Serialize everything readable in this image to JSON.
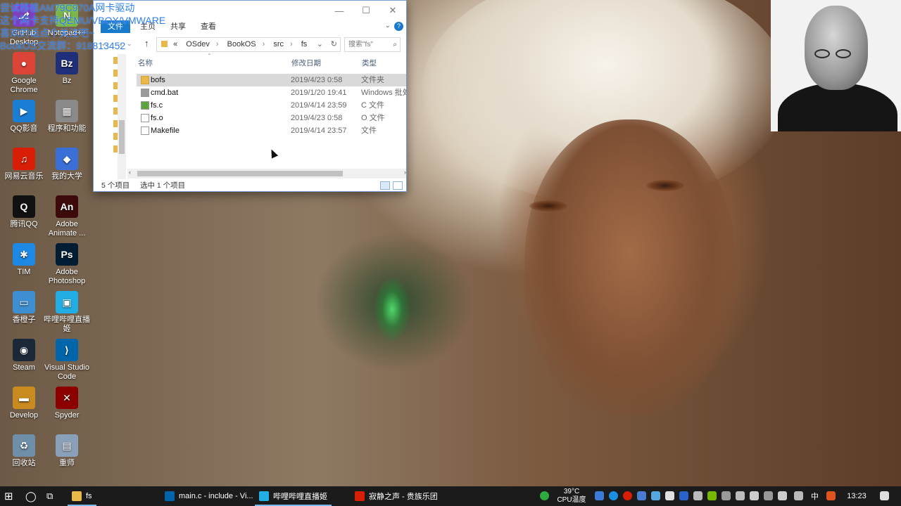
{
  "overlay": {
    "lines": [
      "尝试移植AM79C970A网卡驱动",
      "这个网卡支持QEMU/VBOX/VMWARE",
      "喜欢的话点个关注吧~",
      "BookOS交流群：918813452"
    ]
  },
  "desktop": {
    "icons": [
      {
        "label": "GitHub Desktop",
        "glyph": "⎇",
        "color": "#7b3fbf"
      },
      {
        "label": "Notepad++",
        "glyph": "N",
        "color": "#7ab648"
      },
      {
        "label": "Google Chrome",
        "glyph": "●",
        "color": "#db4437"
      },
      {
        "label": "Bz",
        "glyph": "Bz",
        "color": "#1f2f7a"
      },
      {
        "label": "QQ影音",
        "glyph": "▶",
        "color": "#1a7fd4"
      },
      {
        "label": "程序和功能",
        "glyph": "▦",
        "color": "#8a8a8a"
      },
      {
        "label": "网易云音乐",
        "glyph": "♫",
        "color": "#d81e06"
      },
      {
        "label": "我的大学",
        "glyph": "◆",
        "color": "#3a6fd8"
      },
      {
        "label": "腾讯QQ",
        "glyph": "Q",
        "color": "#111111"
      },
      {
        "label": "Adobe Animate ...",
        "glyph": "An",
        "color": "#3c0a0a"
      },
      {
        "label": "TIM",
        "glyph": "✱",
        "color": "#1e88e5"
      },
      {
        "label": "Adobe Photoshop",
        "glyph": "Ps",
        "color": "#001d34"
      },
      {
        "label": "香橙子",
        "glyph": "▭",
        "color": "#3d8fd1"
      },
      {
        "label": "哔哩哔哩直播姬",
        "glyph": "▣",
        "color": "#23ade5"
      },
      {
        "label": "Steam",
        "glyph": "◉",
        "color": "#1b2838"
      },
      {
        "label": "Visual Studio Code",
        "glyph": "⟩",
        "color": "#0065a9"
      },
      {
        "label": "Develop",
        "glyph": "▬",
        "color": "#c98a1f"
      },
      {
        "label": "Spyder",
        "glyph": "✕",
        "color": "#8c0000"
      },
      {
        "label": "回收站",
        "glyph": "♻",
        "color": "#6f8fa8"
      },
      {
        "label": "重师",
        "glyph": "▤",
        "color": "#8aa0b8"
      }
    ]
  },
  "explorer": {
    "ribbon_tabs": [
      "文件",
      "主页",
      "共享",
      "查看"
    ],
    "address_prefix": "«",
    "breadcrumbs": [
      "OSdev",
      "BookOS",
      "src",
      "fs"
    ],
    "search_placeholder": "搜索\"fs\"",
    "columns": {
      "name": "名称",
      "date": "修改日期",
      "type": "类型"
    },
    "files": [
      {
        "name": "bofs",
        "date": "2019/4/23 0:58",
        "type": "文件夹",
        "kind": "folder",
        "selected": true
      },
      {
        "name": "cmd.bat",
        "date": "2019/1/20 19:41",
        "type": "Windows 批处",
        "kind": "bat",
        "selected": false
      },
      {
        "name": "fs.c",
        "date": "2019/4/14 23:59",
        "type": "C 文件",
        "kind": "c",
        "selected": false
      },
      {
        "name": "fs.o",
        "date": "2019/4/23 0:58",
        "type": "O 文件",
        "kind": "o",
        "selected": false
      },
      {
        "name": "Makefile",
        "date": "2019/4/14 23:57",
        "type": "文件",
        "kind": "file",
        "selected": false
      }
    ],
    "status_count": "5 个项目",
    "status_selected": "选中 1 个项目"
  },
  "taskbar": {
    "windows": [
      {
        "label": "fs",
        "color": "#e8b94a",
        "active": true
      },
      {
        "label": "main.c - include - Vi...",
        "color": "#0065a9",
        "active": false
      },
      {
        "label": "哔哩哔哩直播姬",
        "color": "#23ade5",
        "active": true
      },
      {
        "label": "寂静之声 - 贵族乐团",
        "color": "#d81e06",
        "active": false
      }
    ],
    "temperature": "39°C",
    "temperature_label": "CPU温度",
    "ime": "中",
    "time": "13:23"
  }
}
